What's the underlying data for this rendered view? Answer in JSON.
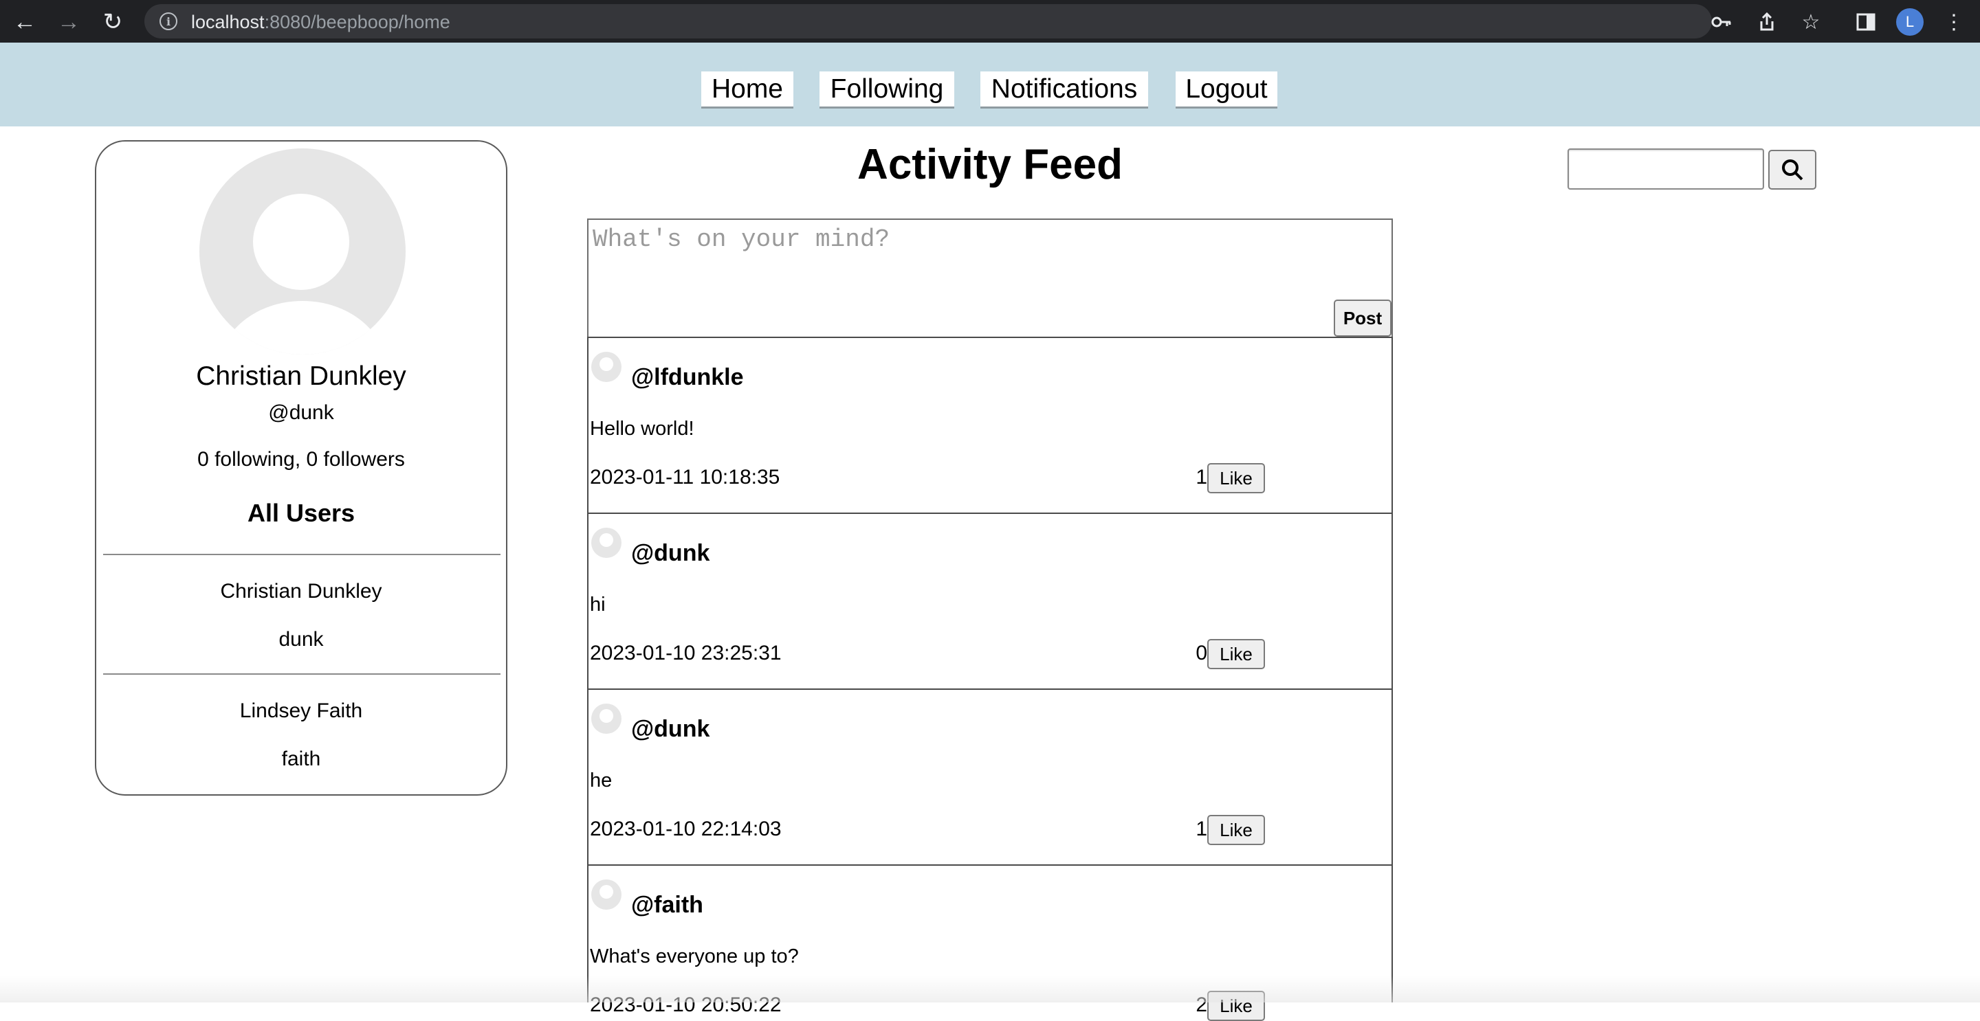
{
  "browser": {
    "url_host": "localhost",
    "url_path": ":8080/beepboop/home",
    "profile_initial": "L"
  },
  "nav": {
    "home": "Home",
    "following": "Following",
    "notifications": "Notifications",
    "logout": "Logout"
  },
  "profile": {
    "name": "Christian Dunkley",
    "handle": "@dunk",
    "stats": "0 following, 0 followers",
    "all_users_heading": "All Users",
    "users": [
      {
        "name": "Christian Dunkley",
        "username": "dunk"
      },
      {
        "name": "Lindsey Faith",
        "username": "faith"
      }
    ]
  },
  "feed": {
    "title": "Activity Feed",
    "composer_placeholder": "What's on your mind?",
    "post_button": "Post",
    "posts": [
      {
        "handle": "@lfdunkle",
        "body": "Hello world!",
        "timestamp": "2023-01-11 10:18:35",
        "likes": "1",
        "like_label": "Like"
      },
      {
        "handle": "@dunk",
        "body": "hi",
        "timestamp": "2023-01-10 23:25:31",
        "likes": "0",
        "like_label": "Like"
      },
      {
        "handle": "@dunk",
        "body": "he",
        "timestamp": "2023-01-10 22:14:03",
        "likes": "1",
        "like_label": "Like"
      },
      {
        "handle": "@faith",
        "body": "What's everyone up to?",
        "timestamp": "2023-01-10 20:50:22",
        "likes": "2",
        "like_label": "Like"
      }
    ]
  },
  "search": {
    "value": "",
    "icon": "search-icon"
  },
  "colors": {
    "nav_bar": "#c4dbe4",
    "chrome": "#202124"
  }
}
